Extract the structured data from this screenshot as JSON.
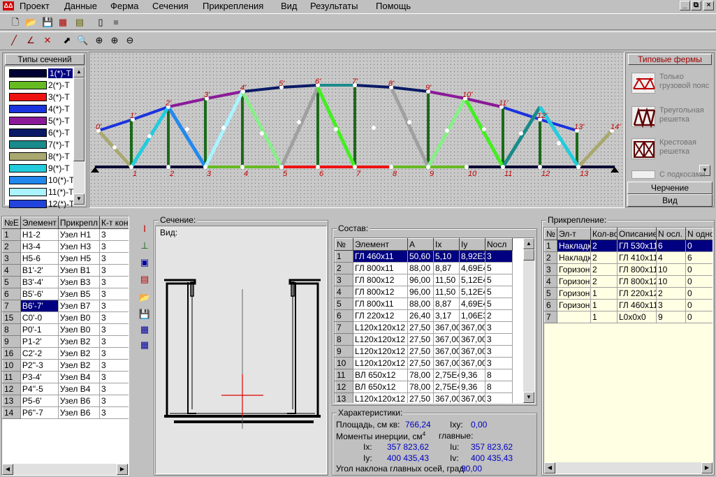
{
  "menu": [
    "Проект",
    "Данные",
    "Ферма",
    "Сечения",
    "Прикрепления",
    "Вид",
    "Результаты",
    "Помощь"
  ],
  "window_buttons": [
    "_",
    "⧉",
    "×"
  ],
  "section_types": {
    "title": "Типы сечений",
    "items": [
      {
        "label": "1(*)-T",
        "color": "#000033"
      },
      {
        "label": "2(*)-T",
        "color": "#66bb22"
      },
      {
        "label": "3(*)-T",
        "color": "#ee1111"
      },
      {
        "label": "4(*)-T",
        "color": "#1a33dd"
      },
      {
        "label": "5(*)-T",
        "color": "#8a1a99"
      },
      {
        "label": "6(*)-T",
        "color": "#0a1a66"
      },
      {
        "label": "7(*)-T",
        "color": "#1a8a8a"
      },
      {
        "label": "8(*)-T",
        "color": "#a8a870"
      },
      {
        "label": "9(*)-T",
        "color": "#22ccdd"
      },
      {
        "label": "10(*)-T",
        "color": "#2288ee"
      },
      {
        "label": "11(*)-T",
        "color": "#aaf4ff"
      },
      {
        "label": "12(*)-T",
        "color": "#2244dd"
      }
    ]
  },
  "typical_trusses": {
    "title": "Типовые фермы",
    "items": [
      "Только грузовой пояс",
      "Треугольная решетка",
      "Крестовая решетка",
      "С подкосами"
    ],
    "btn_draw": "Черчение",
    "btn_view": "Вид"
  },
  "truss": {
    "bottom_labels": [
      "1",
      "2",
      "3",
      "4",
      "5",
      "6",
      "7",
      "8",
      "9",
      "10",
      "11",
      "12",
      "13"
    ],
    "top_labels": [
      "0'",
      "1'",
      "2'",
      "3'",
      "4'",
      "5'",
      "6'",
      "7'",
      "8'",
      "9'",
      "10'",
      "11'",
      "12'",
      "13'",
      "14'"
    ]
  },
  "elements": {
    "headers": [
      "№Е",
      "Элемент",
      "Прикрепл",
      "К-т конц"
    ],
    "rows": [
      [
        "1",
        "H1-2",
        "Узел H1",
        "3"
      ],
      [
        "2",
        "H3-4",
        "Узел H3",
        "3"
      ],
      [
        "3",
        "H5-6",
        "Узел H5",
        "3"
      ],
      [
        "4",
        "B1'-2'",
        "Узел B1",
        "3"
      ],
      [
        "5",
        "B3'-4'",
        "Узел B3",
        "3"
      ],
      [
        "6",
        "B5'-6'",
        "Узел B5",
        "3"
      ],
      [
        "7",
        "B6'-7'",
        "Узел B7",
        "3"
      ],
      [
        "15",
        "C0'-0",
        "Узел B0",
        "3"
      ],
      [
        "8",
        "P0'-1",
        "Узел B0",
        "3"
      ],
      [
        "9",
        "P1-2'",
        "Узел B2",
        "3"
      ],
      [
        "16",
        "C2'-2",
        "Узел B2",
        "3"
      ],
      [
        "10",
        "P2''-3",
        "Узел B2",
        "3"
      ],
      [
        "11",
        "P3-4'",
        "Узел B4",
        "3"
      ],
      [
        "12",
        "P4''-5",
        "Узел B4",
        "3"
      ],
      [
        "13",
        "P5-6'",
        "Узел B6",
        "3"
      ],
      [
        "14",
        "P6''-7",
        "Узел B6",
        "3"
      ]
    ],
    "selected": 6
  },
  "section_group": "Сечение:",
  "view_group": "Вид:",
  "composition": {
    "title": "Состав:",
    "headers": [
      "№",
      "Элемент",
      "A",
      "Ix",
      "Iy",
      "Nосл"
    ],
    "rows": [
      [
        "1",
        "ГЛ 460х11",
        "50,60",
        "5,10",
        "8,92E3",
        "3"
      ],
      [
        "2",
        "ГЛ 800х11",
        "88,00",
        "8,87",
        "4,69E4",
        "5"
      ],
      [
        "3",
        "ГЛ 800х12",
        "96,00",
        "11,50",
        "5,12E4",
        "5"
      ],
      [
        "4",
        "ГЛ 800х12",
        "96,00",
        "11,50",
        "5,12E4",
        "5"
      ],
      [
        "5",
        "ГЛ 800х11",
        "88,00",
        "8,87",
        "4,69E4",
        "5"
      ],
      [
        "6",
        "ГЛ 220х12",
        "26,40",
        "3,17",
        "1,06E3",
        "2"
      ],
      [
        "7",
        "L120x120x12",
        "27,50",
        "367,00",
        "367,00",
        "3"
      ],
      [
        "8",
        "L120x120x12",
        "27,50",
        "367,00",
        "367,00",
        "3"
      ],
      [
        "9",
        "L120x120x12",
        "27,50",
        "367,00",
        "367,00",
        "3"
      ],
      [
        "10",
        "L120x120x12",
        "27,50",
        "367,00",
        "367,00",
        "3"
      ],
      [
        "11",
        "ВЛ 650х12",
        "78,00",
        "2,75E4",
        "9,36",
        "8"
      ],
      [
        "12",
        "ВЛ 650х12",
        "78,00",
        "2,75E4",
        "9,36",
        "8"
      ],
      [
        "13",
        "L120x120x12",
        "27,50",
        "367,00",
        "367,00",
        "3"
      ]
    ]
  },
  "characteristics": {
    "title": "Характеристики:",
    "area_label": "Площадь, см кв:",
    "area": "766,24",
    "ixy_label": "Ixy:",
    "ixy": "0,00",
    "inertia_label": "Моменты инерции, см",
    "inertia_sup": "4",
    "main_label": "главные:",
    "ix_label": "Ix:",
    "ix": "357 823,62",
    "iu_label": "Iu:",
    "iu": "357 823,62",
    "iy_label": "Iy:",
    "iy": "400 435,43",
    "iv_label": "Iv:",
    "iv": "400 435,43",
    "angle_label": "Угол наклона главных осей, град:",
    "angle": "90,00"
  },
  "attachment": {
    "title": "Прикрепление:",
    "headers": [
      "№",
      "Эл-т",
      "Кол-во",
      "Описание",
      "N осл.",
      "N одно"
    ],
    "rows": [
      [
        "1",
        "Накладк",
        "2",
        "ГЛ 530х11",
        "6",
        "0"
      ],
      [
        "2",
        "Накладк",
        "2",
        "ГЛ 410х11",
        "4",
        "6"
      ],
      [
        "3",
        "Горизон",
        "2",
        "ГЛ 800х11",
        "10",
        "0"
      ],
      [
        "4",
        "Горизон",
        "2",
        "ГЛ 800х12",
        "10",
        "0"
      ],
      [
        "5",
        "Горизон",
        "1",
        "ГЛ 220х12",
        "2",
        "0"
      ],
      [
        "6",
        "Горизон",
        "1",
        "ГЛ 460х11",
        "3",
        "0"
      ],
      [
        "7",
        "",
        "1",
        "L0x0x0",
        "9",
        "0"
      ]
    ]
  }
}
